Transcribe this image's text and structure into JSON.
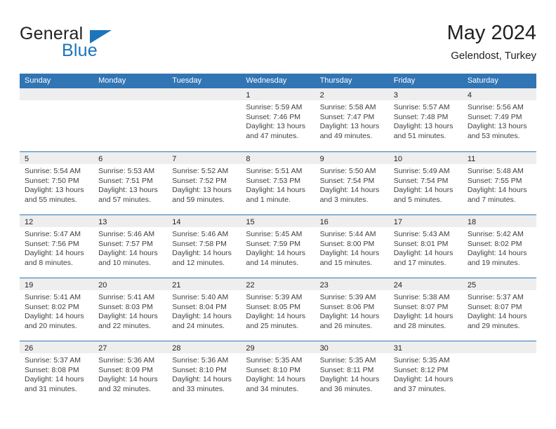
{
  "brand": {
    "name_part1": "General",
    "name_part2": "Blue",
    "logo_icon": "triangle-logo-icon"
  },
  "header": {
    "title": "May 2024",
    "subtitle": "Gelendost, Turkey"
  },
  "colors": {
    "header_blue": "#3175b4",
    "brand_blue": "#1b75bb",
    "day_strip_gray": "#eeeeee",
    "text": "#231f20"
  },
  "calendar": {
    "weekdays": [
      "Sunday",
      "Monday",
      "Tuesday",
      "Wednesday",
      "Thursday",
      "Friday",
      "Saturday"
    ],
    "weeks": [
      [
        {
          "day": "",
          "empty": true
        },
        {
          "day": "",
          "empty": true
        },
        {
          "day": "",
          "empty": true
        },
        {
          "day": "1",
          "sunrise": "Sunrise: 5:59 AM",
          "sunset": "Sunset: 7:46 PM",
          "daylight1": "Daylight: 13 hours",
          "daylight2": "and 47 minutes."
        },
        {
          "day": "2",
          "sunrise": "Sunrise: 5:58 AM",
          "sunset": "Sunset: 7:47 PM",
          "daylight1": "Daylight: 13 hours",
          "daylight2": "and 49 minutes."
        },
        {
          "day": "3",
          "sunrise": "Sunrise: 5:57 AM",
          "sunset": "Sunset: 7:48 PM",
          "daylight1": "Daylight: 13 hours",
          "daylight2": "and 51 minutes."
        },
        {
          "day": "4",
          "sunrise": "Sunrise: 5:56 AM",
          "sunset": "Sunset: 7:49 PM",
          "daylight1": "Daylight: 13 hours",
          "daylight2": "and 53 minutes."
        }
      ],
      [
        {
          "day": "5",
          "sunrise": "Sunrise: 5:54 AM",
          "sunset": "Sunset: 7:50 PM",
          "daylight1": "Daylight: 13 hours",
          "daylight2": "and 55 minutes."
        },
        {
          "day": "6",
          "sunrise": "Sunrise: 5:53 AM",
          "sunset": "Sunset: 7:51 PM",
          "daylight1": "Daylight: 13 hours",
          "daylight2": "and 57 minutes."
        },
        {
          "day": "7",
          "sunrise": "Sunrise: 5:52 AM",
          "sunset": "Sunset: 7:52 PM",
          "daylight1": "Daylight: 13 hours",
          "daylight2": "and 59 minutes."
        },
        {
          "day": "8",
          "sunrise": "Sunrise: 5:51 AM",
          "sunset": "Sunset: 7:53 PM",
          "daylight1": "Daylight: 14 hours",
          "daylight2": "and 1 minute."
        },
        {
          "day": "9",
          "sunrise": "Sunrise: 5:50 AM",
          "sunset": "Sunset: 7:54 PM",
          "daylight1": "Daylight: 14 hours",
          "daylight2": "and 3 minutes."
        },
        {
          "day": "10",
          "sunrise": "Sunrise: 5:49 AM",
          "sunset": "Sunset: 7:54 PM",
          "daylight1": "Daylight: 14 hours",
          "daylight2": "and 5 minutes."
        },
        {
          "day": "11",
          "sunrise": "Sunrise: 5:48 AM",
          "sunset": "Sunset: 7:55 PM",
          "daylight1": "Daylight: 14 hours",
          "daylight2": "and 7 minutes."
        }
      ],
      [
        {
          "day": "12",
          "sunrise": "Sunrise: 5:47 AM",
          "sunset": "Sunset: 7:56 PM",
          "daylight1": "Daylight: 14 hours",
          "daylight2": "and 8 minutes."
        },
        {
          "day": "13",
          "sunrise": "Sunrise: 5:46 AM",
          "sunset": "Sunset: 7:57 PM",
          "daylight1": "Daylight: 14 hours",
          "daylight2": "and 10 minutes."
        },
        {
          "day": "14",
          "sunrise": "Sunrise: 5:46 AM",
          "sunset": "Sunset: 7:58 PM",
          "daylight1": "Daylight: 14 hours",
          "daylight2": "and 12 minutes."
        },
        {
          "day": "15",
          "sunrise": "Sunrise: 5:45 AM",
          "sunset": "Sunset: 7:59 PM",
          "daylight1": "Daylight: 14 hours",
          "daylight2": "and 14 minutes."
        },
        {
          "day": "16",
          "sunrise": "Sunrise: 5:44 AM",
          "sunset": "Sunset: 8:00 PM",
          "daylight1": "Daylight: 14 hours",
          "daylight2": "and 15 minutes."
        },
        {
          "day": "17",
          "sunrise": "Sunrise: 5:43 AM",
          "sunset": "Sunset: 8:01 PM",
          "daylight1": "Daylight: 14 hours",
          "daylight2": "and 17 minutes."
        },
        {
          "day": "18",
          "sunrise": "Sunrise: 5:42 AM",
          "sunset": "Sunset: 8:02 PM",
          "daylight1": "Daylight: 14 hours",
          "daylight2": "and 19 minutes."
        }
      ],
      [
        {
          "day": "19",
          "sunrise": "Sunrise: 5:41 AM",
          "sunset": "Sunset: 8:02 PM",
          "daylight1": "Daylight: 14 hours",
          "daylight2": "and 20 minutes."
        },
        {
          "day": "20",
          "sunrise": "Sunrise: 5:41 AM",
          "sunset": "Sunset: 8:03 PM",
          "daylight1": "Daylight: 14 hours",
          "daylight2": "and 22 minutes."
        },
        {
          "day": "21",
          "sunrise": "Sunrise: 5:40 AM",
          "sunset": "Sunset: 8:04 PM",
          "daylight1": "Daylight: 14 hours",
          "daylight2": "and 24 minutes."
        },
        {
          "day": "22",
          "sunrise": "Sunrise: 5:39 AM",
          "sunset": "Sunset: 8:05 PM",
          "daylight1": "Daylight: 14 hours",
          "daylight2": "and 25 minutes."
        },
        {
          "day": "23",
          "sunrise": "Sunrise: 5:39 AM",
          "sunset": "Sunset: 8:06 PM",
          "daylight1": "Daylight: 14 hours",
          "daylight2": "and 26 minutes."
        },
        {
          "day": "24",
          "sunrise": "Sunrise: 5:38 AM",
          "sunset": "Sunset: 8:07 PM",
          "daylight1": "Daylight: 14 hours",
          "daylight2": "and 28 minutes."
        },
        {
          "day": "25",
          "sunrise": "Sunrise: 5:37 AM",
          "sunset": "Sunset: 8:07 PM",
          "daylight1": "Daylight: 14 hours",
          "daylight2": "and 29 minutes."
        }
      ],
      [
        {
          "day": "26",
          "sunrise": "Sunrise: 5:37 AM",
          "sunset": "Sunset: 8:08 PM",
          "daylight1": "Daylight: 14 hours",
          "daylight2": "and 31 minutes."
        },
        {
          "day": "27",
          "sunrise": "Sunrise: 5:36 AM",
          "sunset": "Sunset: 8:09 PM",
          "daylight1": "Daylight: 14 hours",
          "daylight2": "and 32 minutes."
        },
        {
          "day": "28",
          "sunrise": "Sunrise: 5:36 AM",
          "sunset": "Sunset: 8:10 PM",
          "daylight1": "Daylight: 14 hours",
          "daylight2": "and 33 minutes."
        },
        {
          "day": "29",
          "sunrise": "Sunrise: 5:35 AM",
          "sunset": "Sunset: 8:10 PM",
          "daylight1": "Daylight: 14 hours",
          "daylight2": "and 34 minutes."
        },
        {
          "day": "30",
          "sunrise": "Sunrise: 5:35 AM",
          "sunset": "Sunset: 8:11 PM",
          "daylight1": "Daylight: 14 hours",
          "daylight2": "and 36 minutes."
        },
        {
          "day": "31",
          "sunrise": "Sunrise: 5:35 AM",
          "sunset": "Sunset: 8:12 PM",
          "daylight1": "Daylight: 14 hours",
          "daylight2": "and 37 minutes."
        },
        {
          "day": "",
          "empty": true
        }
      ]
    ]
  }
}
